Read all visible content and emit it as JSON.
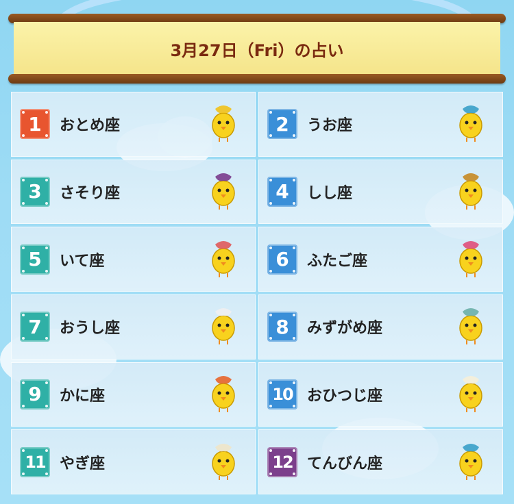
{
  "header": {
    "title": "3月27日（Fri）の占い"
  },
  "colors": {
    "red": "#e8552f",
    "blue": "#3a8fd8",
    "teal": "#2fb0a6",
    "purple": "#7c3f8c"
  },
  "rankings": [
    {
      "rank": "1",
      "sign": "おとめ座",
      "badge_color": "#e8552f",
      "icon": "virgo-chick-icon"
    },
    {
      "rank": "2",
      "sign": "うお座",
      "badge_color": "#3a8fd8",
      "icon": "pisces-chick-icon"
    },
    {
      "rank": "3",
      "sign": "さそり座",
      "badge_color": "#2fb0a6",
      "icon": "scorpio-chick-icon"
    },
    {
      "rank": "4",
      "sign": "しし座",
      "badge_color": "#3a8fd8",
      "icon": "leo-chick-icon"
    },
    {
      "rank": "5",
      "sign": "いて座",
      "badge_color": "#2fb0a6",
      "icon": "sagittarius-chick-icon"
    },
    {
      "rank": "6",
      "sign": "ふたご座",
      "badge_color": "#3a8fd8",
      "icon": "gemini-chick-icon"
    },
    {
      "rank": "7",
      "sign": "おうし座",
      "badge_color": "#2fb0a6",
      "icon": "taurus-chick-icon"
    },
    {
      "rank": "8",
      "sign": "みずがめ座",
      "badge_color": "#3a8fd8",
      "icon": "aquarius-chick-icon"
    },
    {
      "rank": "9",
      "sign": "かに座",
      "badge_color": "#2fb0a6",
      "icon": "cancer-chick-icon"
    },
    {
      "rank": "10",
      "sign": "おひつじ座",
      "badge_color": "#3a8fd8",
      "icon": "aries-chick-icon"
    },
    {
      "rank": "11",
      "sign": "やぎ座",
      "badge_color": "#2fb0a6",
      "icon": "capricorn-chick-icon"
    },
    {
      "rank": "12",
      "sign": "てんびん座",
      "badge_color": "#7c3f8c",
      "icon": "libra-chick-icon"
    }
  ]
}
